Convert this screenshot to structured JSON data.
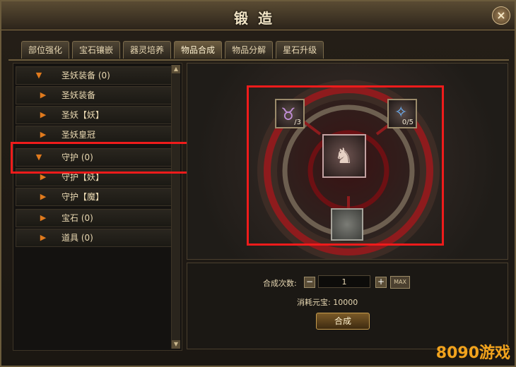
{
  "window": {
    "title": "锻造"
  },
  "tabs": [
    {
      "label": "部位强化"
    },
    {
      "label": "宝石镶嵌"
    },
    {
      "label": "器灵培养"
    },
    {
      "label": "物品合成",
      "active": true
    },
    {
      "label": "物品分解"
    },
    {
      "label": "星石升级"
    }
  ],
  "tree": [
    {
      "label": "圣妖装备 (0)",
      "level": 0,
      "expanded": true
    },
    {
      "label": "圣妖装备",
      "level": 1,
      "expanded": false
    },
    {
      "label": "圣妖【妖】",
      "level": 1,
      "expanded": false
    },
    {
      "label": "圣妖皇冠",
      "level": 1,
      "expanded": false
    },
    {
      "label": "守护 (0)",
      "level": 0,
      "expanded": true
    },
    {
      "label": "守护【妖】",
      "level": 1,
      "expanded": false
    },
    {
      "label": "守护【魔】",
      "level": 1,
      "expanded": false
    },
    {
      "label": "宝石 (0)",
      "level": 0,
      "expanded": false
    },
    {
      "label": "道具 (0)",
      "level": 0,
      "expanded": false
    }
  ],
  "forge": {
    "left_count": "/3",
    "right_count": "0/5"
  },
  "controls": {
    "quantity_label": "合成次数:",
    "quantity_value": "1",
    "max_label": "MAX",
    "cost_label": "消耗元宝: 10000",
    "forge_button": "合成"
  },
  "watermark": "8090游戏",
  "colors": {
    "highlight": "#ef1b1b",
    "arrow": "#e07a1d"
  }
}
